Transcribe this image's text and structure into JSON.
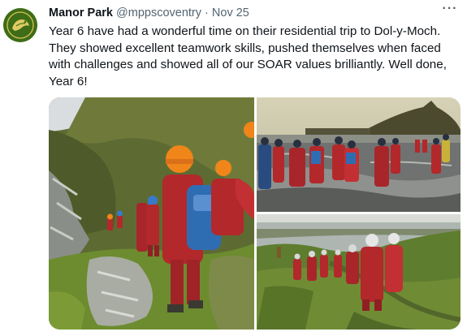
{
  "tweet": {
    "author_name": "Manor Park",
    "author_handle": "@mppscoventry",
    "separator": "·",
    "date": "Nov 25",
    "more_label": "···",
    "text": "Year 6 have had a wonderful time on their residential trip to Dol-y-Moch. They showed excellent teamwork skills, pushed themselves when faced with challenges and showed all of our SOAR values brilliantly. Well done, Year 6!"
  },
  "media": [
    {
      "subject": "pupils in red waterproofs and orange helmets climbing a rocky slope"
    },
    {
      "subject": "group in red waterproofs walking through shallow water on a beach"
    },
    {
      "subject": "group in red waterproofs walking along a grassy coastal path"
    }
  ],
  "colors": {
    "text": "#0f1419",
    "secondary": "#536471",
    "waterproofs": "#b3282b",
    "helmet": "#f0861a",
    "avatar_bg": "#3f6d17"
  }
}
